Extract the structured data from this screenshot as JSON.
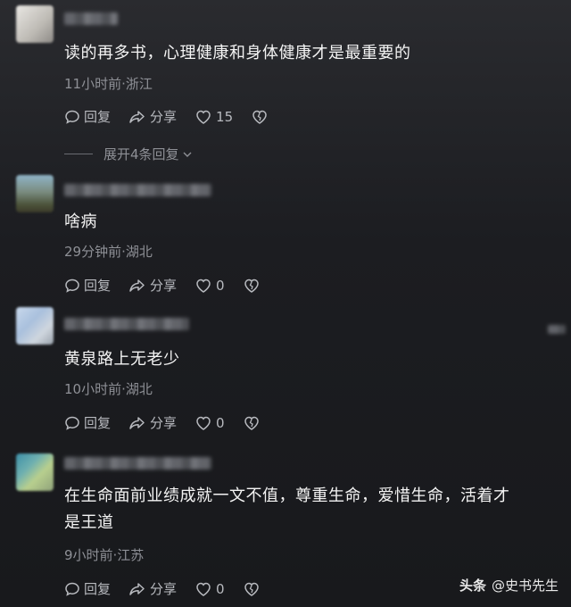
{
  "comments": [
    {
      "text": "读的再多书，心理健康和身体健康才是最重要的",
      "meta": "11小时前·浙江",
      "reply_label": "回复",
      "share_label": "分享",
      "likes": "15"
    },
    {
      "text": "啥病",
      "meta": "29分钟前·湖北",
      "reply_label": "回复",
      "share_label": "分享",
      "likes": "0"
    },
    {
      "text": "黄泉路上无老少",
      "meta": "10小时前·湖北",
      "reply_label": "回复",
      "share_label": "分享",
      "likes": "0"
    },
    {
      "text_line1": "在生命面前业绩成就一文不值，尊重生命，爱惜生命，活着才",
      "text_line2": "是王道",
      "meta": "9小时前·江苏",
      "reply_label": "回复",
      "share_label": "分享",
      "likes": "0"
    }
  ],
  "expand_replies_label": "展开4条回复",
  "watermark": {
    "brand": "头条",
    "handle": "@史书先生"
  },
  "colors": {
    "background": "#1c1d21",
    "text": "#f4f4f4",
    "muted": "#8e9096"
  }
}
